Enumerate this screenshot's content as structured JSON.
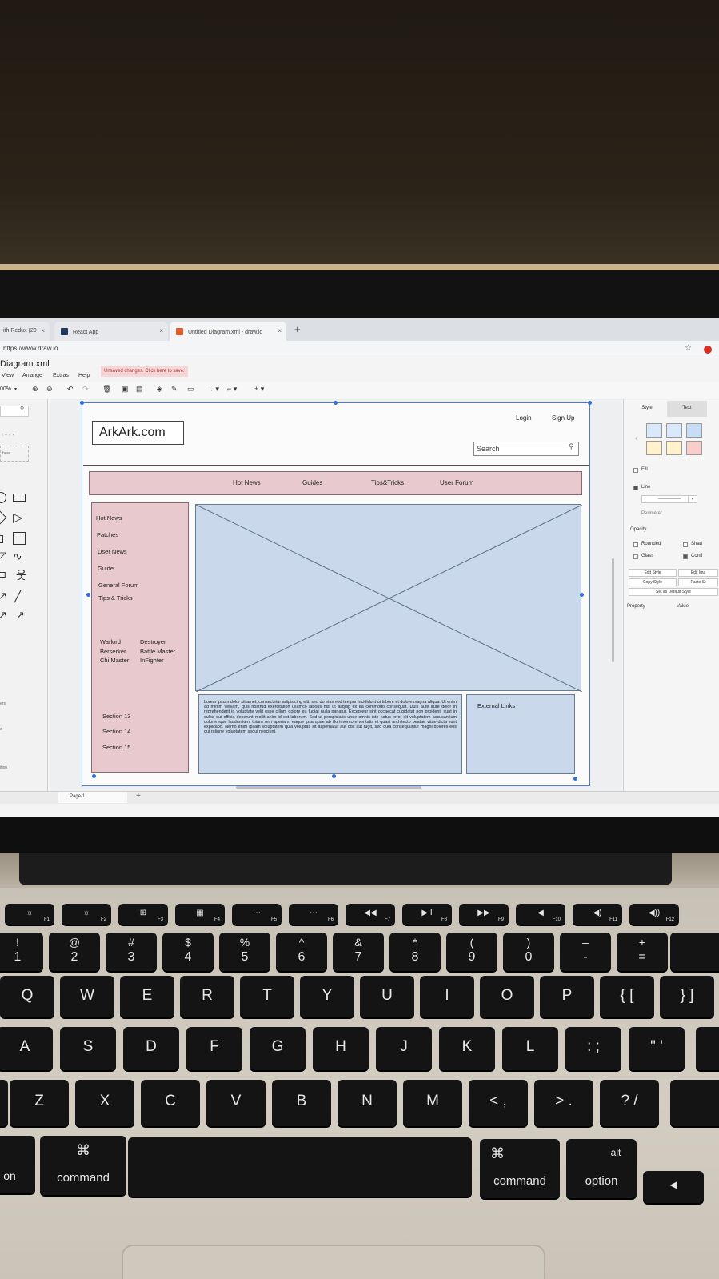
{
  "browser": {
    "tabs": [
      {
        "label": "ith Redux (20",
        "close": "×"
      },
      {
        "label": "React App",
        "close": "×"
      },
      {
        "label": "Untitled Diagram.xml - draw.io",
        "close": "×"
      }
    ],
    "new_tab": "+",
    "url": "https://www.draw.io"
  },
  "app": {
    "title": "Diagram.xml",
    "menus": [
      "View",
      "Arrange",
      "Extras",
      "Help"
    ],
    "unsaved_notice": "Unsaved changes. Click here to save.",
    "zoom": "00%",
    "page_tab": "Page-1",
    "add_page": "+"
  },
  "left_panel": {
    "search_placeholder": "here",
    "labels": [
      "ers",
      "s",
      "ition"
    ]
  },
  "right_panel": {
    "tabs": [
      "Style",
      "Text"
    ],
    "swatch_colors": [
      "#dae8fc",
      "#dae8fc",
      "#c5def5",
      "#fff2cc",
      "#fff2cc",
      "#f8cecc"
    ],
    "fill_label": "Fill",
    "line_label": "Line",
    "perimeter_label": "Perimeter",
    "opacity_label": "Opacity",
    "rounded_label": "Rounded",
    "shadow_label": "Shad",
    "glass_label": "Glass",
    "comic_label": "Comi",
    "edit_style": "Edit Style",
    "edit_image": "Edit Ima",
    "copy_style": "Copy Style",
    "paste_style": "Paste St",
    "set_default": "Set as Default Style",
    "property_header": "Property",
    "value_header": "Value"
  },
  "mockup": {
    "logo": "ArkArk.com",
    "login": "Login",
    "signup": "Sign Up",
    "search_placeholder": "Search",
    "nav": [
      "Hot News",
      "Guides",
      "Tips&Tricks",
      "User Forum"
    ],
    "left_links": [
      "Hot News",
      "Patches",
      "User News",
      "Guide",
      "General Forum",
      "Tips & Tricks"
    ],
    "classes_col1": [
      "Warlord",
      "Berserker",
      "Chi Master"
    ],
    "classes_col2": [
      "Destroyer",
      "Battle Master",
      "InFighter"
    ],
    "sections": [
      "Section 13",
      "Section 14",
      "Section 15"
    ],
    "lorem": "Lorem ipsum dolor sit amet, consectetur adipisicing elit, sed do eiusmod tempor incididunt ut labore et dolore magna aliqua. Ut enim ad minim veniam, quis nostrud exercitation ullamco laboris nisi ut aliquip ex ea commodo consequat. Duis aute irure dolor in reprehenderit in voluptate velit esse cillum dolore eu fugiat nulla pariatur. Excepteur sint occaecat cupidatat non proident, sunt in culpa qui officia deserunt mollit anim id est laborum. Sed ut perspiciatis unde omnis iste natus error sit voluptatem accusantium doloremque laudantium, totam rem aperiam, eaque ipsa quae ab illo inventore veritatis et quasi architecto beatae vitae dicta sunt explicabo. Nemo enim ipsam voluptatem quia voluptas sit aspernatur aut odit aut fugit, sed quia consequuntur magni dolores eos qui ratione voluptatem sequi nesciunt.",
    "external_links": "External Links"
  },
  "keyboard": {
    "fkeys": [
      {
        "label": "☼",
        "sub": "F1"
      },
      {
        "label": "☼",
        "sub": "F2"
      },
      {
        "label": "⊞",
        "sub": "F3"
      },
      {
        "label": "▦",
        "sub": "F4"
      },
      {
        "label": "⋯",
        "sub": "F5"
      },
      {
        "label": "⋯",
        "sub": "F6"
      },
      {
        "label": "◀◀",
        "sub": "F7"
      },
      {
        "label": "▶II",
        "sub": "F8"
      },
      {
        "label": "▶▶",
        "sub": "F9"
      },
      {
        "label": "◀",
        "sub": "F10"
      },
      {
        "label": "◀)",
        "sub": "F11"
      },
      {
        "label": "◀))",
        "sub": "F12"
      }
    ],
    "numbers": [
      {
        "top": "!",
        "bot": "1"
      },
      {
        "top": "@",
        "bot": "2"
      },
      {
        "top": "#",
        "bot": "3"
      },
      {
        "top": "$",
        "bot": "4"
      },
      {
        "top": "%",
        "bot": "5"
      },
      {
        "top": "^",
        "bot": "6"
      },
      {
        "top": "&",
        "bot": "7"
      },
      {
        "top": "*",
        "bot": "8"
      },
      {
        "top": "(",
        "bot": "9"
      },
      {
        "top": ")",
        "bot": "0"
      },
      {
        "top": "–",
        "bot": "-"
      },
      {
        "top": "+",
        "bot": "="
      }
    ],
    "row_q": [
      "Q",
      "W",
      "E",
      "R",
      "T",
      "Y",
      "U",
      "I",
      "O",
      "P",
      "{ [",
      "} ]"
    ],
    "row_a": [
      "A",
      "S",
      "D",
      "F",
      "G",
      "H",
      "J",
      "K",
      "L",
      ": ;",
      "\" '"
    ],
    "row_z": [
      "Z",
      "X",
      "C",
      "V",
      "B",
      "N",
      "M",
      "< ,",
      "> .",
      "? /"
    ],
    "command_symbol": "⌘",
    "command_label": "command",
    "alt_label": "alt",
    "option_label": "option",
    "on_label": "on",
    "left_arrow": "◀"
  }
}
